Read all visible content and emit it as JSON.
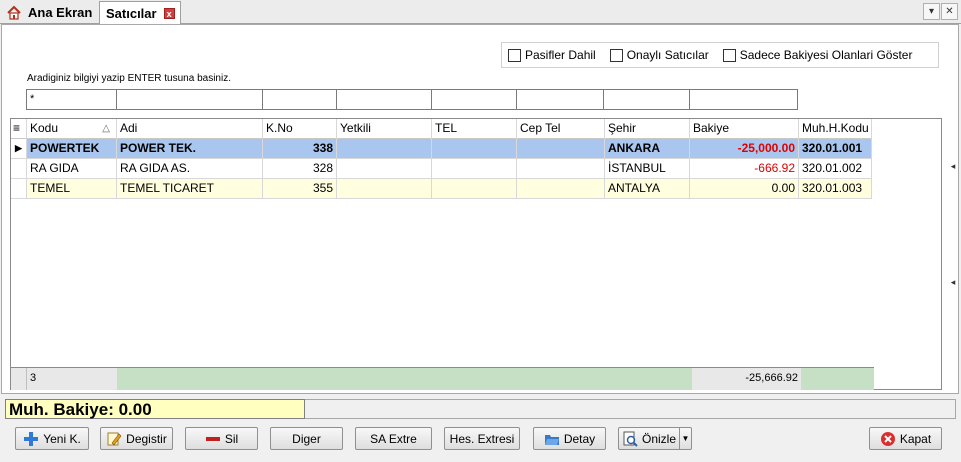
{
  "tabs": {
    "home_label": "Ana Ekran",
    "active_label": "Satıcılar",
    "close_glyph": "x"
  },
  "filters": {
    "pasif_label": "Pasifler Dahil",
    "onayli_label": "Onaylı Satıcılar",
    "bakiye_label": "Sadece Bakiyesi Olanlari Göster",
    "hint": "Aradiginiz bilgiyi yazip ENTER tusuna basiniz.",
    "search_value": "*"
  },
  "grid": {
    "columns": [
      "Kodu",
      "Adi",
      "K.No",
      "Yetkili",
      "TEL",
      "Cep Tel",
      "Şehir",
      "Bakiye",
      "Muh.H.Kodu"
    ],
    "rows": [
      {
        "kodu": "POWERTEK",
        "adi": "POWER TEK.",
        "kno": "338",
        "yetkili": "",
        "tel": "",
        "cep": "",
        "sehir": "ANKARA",
        "bakiye": "-25,000.00",
        "muh": "320.01.001"
      },
      {
        "kodu": "RA GIDA",
        "adi": "RA GIDA AS.",
        "kno": "328",
        "yetkili": "",
        "tel": "",
        "cep": "",
        "sehir": "İSTANBUL",
        "bakiye": "-666.92",
        "muh": "320.01.002"
      },
      {
        "kodu": "TEMEL",
        "adi": "TEMEL TICARET",
        "kno": "355",
        "yetkili": "",
        "tel": "",
        "cep": "",
        "sehir": "ANTALYA",
        "bakiye": "0.00",
        "muh": "320.01.003"
      }
    ],
    "footer_count": "3",
    "footer_total": "-25,666.92"
  },
  "status": {
    "muh_bakiye": "Muh. Bakiye: 0.00"
  },
  "buttons": {
    "yeni": "Yeni K.",
    "degistir": "Degistir",
    "sil": "Sil",
    "diger": "Diger",
    "saextre": "SA Extre",
    "hesextre": "Hes. Extresi",
    "detay": "Detay",
    "onizle": "Önizle",
    "kapat": "Kapat"
  },
  "colors": {
    "selected_row": "#a9c7ee",
    "alt_row": "#ffffe0",
    "negative": "#e00000",
    "summary_green": "#c6e0c6",
    "muh_bg": "#ffffc0"
  }
}
